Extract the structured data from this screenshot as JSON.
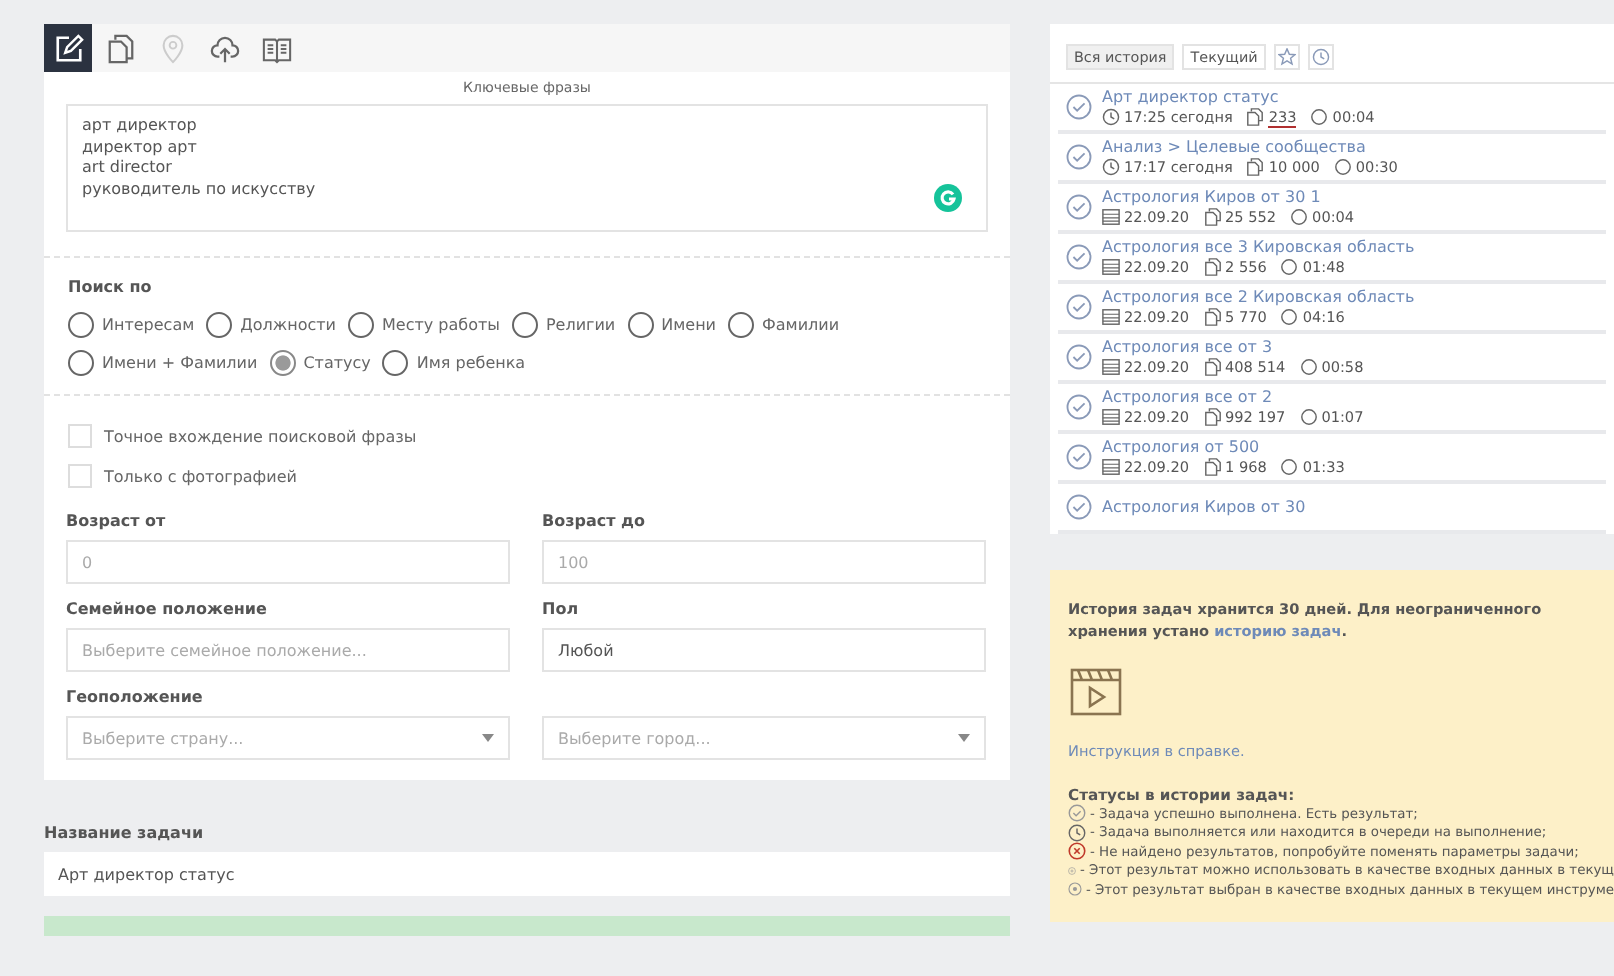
{
  "tabs": [
    {
      "selected": true,
      "disabled": false
    },
    {
      "selected": false,
      "disabled": false
    },
    {
      "selected": false,
      "disabled": true
    },
    {
      "selected": false,
      "disabled": false
    },
    {
      "selected": false,
      "disabled": false
    }
  ],
  "keywords": {
    "label": "Ключевые фразы",
    "value": "арт директор\nдиректор арт\nart director\nруководитель по искусству"
  },
  "search_by": {
    "label": "Поиск по",
    "options": [
      {
        "label": "Интересам",
        "selected": false
      },
      {
        "label": "Должности",
        "selected": false
      },
      {
        "label": "Месту работы",
        "selected": false
      },
      {
        "label": "Религии",
        "selected": false
      },
      {
        "label": "Имени",
        "selected": false
      },
      {
        "label": "Фамилии",
        "selected": false
      },
      {
        "label": "Имени + Фамилии",
        "selected": false
      },
      {
        "label": "Статусу",
        "selected": true
      },
      {
        "label": "Имя ребенка",
        "selected": false
      }
    ]
  },
  "checkboxes": [
    {
      "label": "Точное вхождение поисковой фразы",
      "checked": false
    },
    {
      "label": "Только с фотографией",
      "checked": false
    }
  ],
  "fields": [
    {
      "label": "Возраст от",
      "placeholder": "0",
      "kind": "input"
    },
    {
      "label": "Возраст до",
      "placeholder": "100",
      "kind": "input"
    },
    {
      "label": "Семейное положение",
      "placeholder": "Выберите семейное положение...",
      "kind": "input"
    },
    {
      "label": "Пол",
      "value": "Любой",
      "kind": "input"
    },
    {
      "label": "Геоположение",
      "placeholder": "Выберите страну...",
      "kind": "select"
    },
    {
      "placeholder": "Выберите город...",
      "kind": "select"
    }
  ],
  "task_name": {
    "label": "Название задачи",
    "value": "Арт директор статус"
  },
  "history": {
    "filters": [
      {
        "label": "Вся история",
        "selected": true
      },
      {
        "label": "Текущий",
        "selected": false
      }
    ],
    "items": [
      {
        "title": "Арт директор статус",
        "kind": "today",
        "time": "17:25 сегодня",
        "count": "233",
        "duration": "00:04",
        "underlined": true
      },
      {
        "title": "Анализ > Целевые сообщества",
        "kind": "today",
        "time": "17:17 сегодня",
        "count": "10 000",
        "duration": "00:30",
        "underlined": false
      },
      {
        "title": "Астрология Киров от 30 1",
        "kind": "dated",
        "time": "22.09.20",
        "count": "25 552",
        "duration": "00:04",
        "underlined": false
      },
      {
        "title": "Астрология все 3 Кировская область",
        "kind": "dated",
        "time": "22.09.20",
        "count": "2 556",
        "duration": "01:48",
        "underlined": false
      },
      {
        "title": "Астрология все 2 Кировская область",
        "kind": "dated",
        "time": "22.09.20",
        "count": "5 770",
        "duration": "04:16",
        "underlined": false
      },
      {
        "title": "Астрология все от 3",
        "kind": "dated",
        "time": "22.09.20",
        "count": "408 514",
        "duration": "00:58",
        "underlined": false
      },
      {
        "title": "Астрология все от 2",
        "kind": "dated",
        "time": "22.09.20",
        "count": "992 197",
        "duration": "01:07",
        "underlined": false
      },
      {
        "title": "Астрология от 500",
        "kind": "dated",
        "time": "22.09.20",
        "count": "1 968",
        "duration": "01:33",
        "underlined": false
      },
      {
        "title": "Астрология Киров от 30",
        "kind": "title_only"
      }
    ]
  },
  "info": {
    "text": "История задач хранится 30 дней. Для неограниченного хранения устано",
    "link": "историю задач",
    "link_tail": ".",
    "help_link": "Инструкция в справке.",
    "statuses_title": "Статусы в истории задач:",
    "statuses": [
      {
        "kind": "success",
        "text": "- Задача успешно выполнена. Есть результат;"
      },
      {
        "kind": "pending",
        "text": "- Задача выполняется или находится в очереди на выполнение;"
      },
      {
        "kind": "empty",
        "text": "- Не найдено результатов, попробуйте поменять параметры задачи;"
      },
      {
        "kind": "usable",
        "text": "- Этот результат можно использовать в качестве входных данных в текущ"
      },
      {
        "kind": "chosen",
        "text": "- Этот результат выбран в качестве входных данных в текущем инструме"
      }
    ]
  }
}
